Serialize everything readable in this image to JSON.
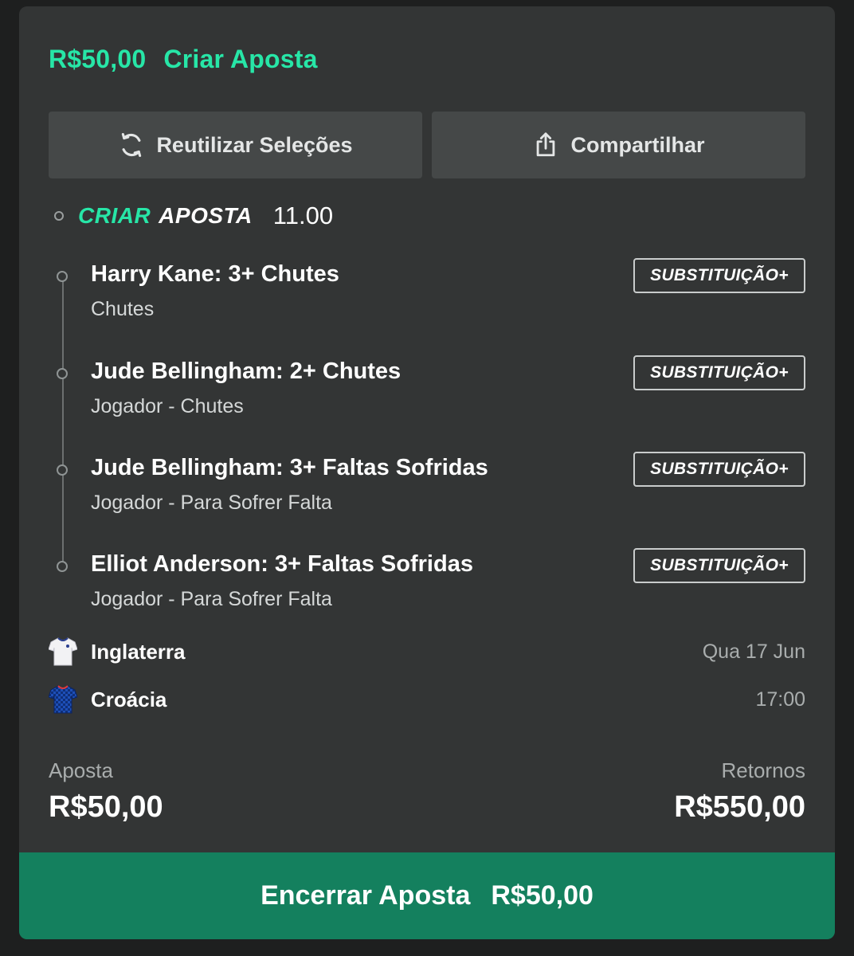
{
  "header": {
    "amount": "R$50,00",
    "title": "Criar Aposta"
  },
  "actions": {
    "reuse_label": "Reutilizar Seleções",
    "share_label": "Compartilhar"
  },
  "bet_builder": {
    "logo_part1": "CRIAR",
    "logo_part2": "APOSTA",
    "odds": "11.00"
  },
  "selections": [
    {
      "title": "Harry Kane: 3+ Chutes",
      "market": "Chutes",
      "badge": "SUBSTITUIÇÃO+"
    },
    {
      "title": "Jude Bellingham: 2+ Chutes",
      "market": "Jogador - Chutes",
      "badge": "SUBSTITUIÇÃO+"
    },
    {
      "title": "Jude Bellingham: 3+ Faltas Sofridas",
      "market": "Jogador - Para Sofrer Falta",
      "badge": "SUBSTITUIÇÃO+"
    },
    {
      "title": "Elliot Anderson: 3+ Faltas Sofridas",
      "market": "Jogador - Para Sofrer Falta",
      "badge": "SUBSTITUIÇÃO+"
    }
  ],
  "match": {
    "home": {
      "name": "Inglaterra",
      "kit_icon": "white-shirt-icon"
    },
    "away": {
      "name": "Croácia",
      "kit_icon": "blue-checkered-shirt-icon"
    },
    "date": "Qua 17 Jun",
    "time": "17:00"
  },
  "summary": {
    "stake_label": "Aposta",
    "stake_value": "R$50,00",
    "returns_label": "Retornos",
    "returns_value": "R$550,00"
  },
  "cashout": {
    "label": "Encerrar Aposta",
    "amount": "R$50,00"
  },
  "colors": {
    "accent": "#27e6a7",
    "cashout_bg": "#14805e",
    "card_bg": "#333535",
    "page_bg": "#1e1f1f"
  }
}
